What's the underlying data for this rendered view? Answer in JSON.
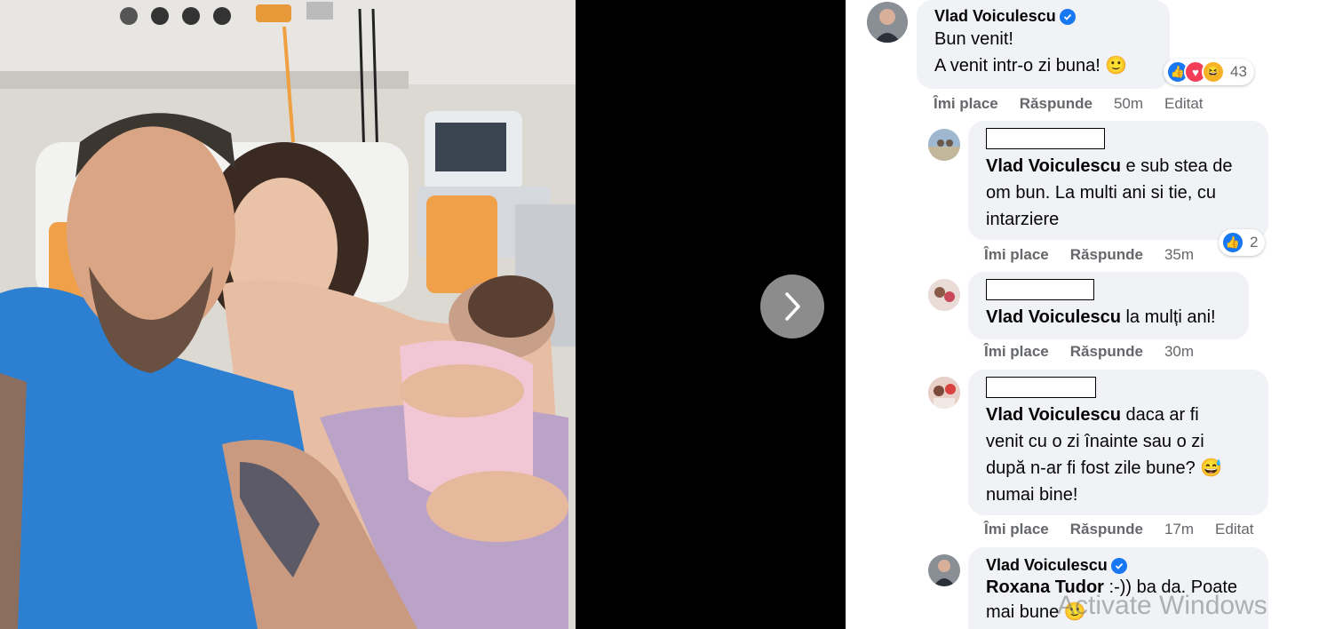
{
  "next_button_label": "›",
  "comments": [
    {
      "author": "Vlad Voiculescu",
      "verified": true,
      "lines": [
        "Bun venit!",
        "A venit intr-o zi buna! 🙂"
      ],
      "reactions": [
        "like",
        "love",
        "haha"
      ],
      "reaction_count": "43",
      "like_label": "Îmi place",
      "reply_label": "Răspunde",
      "time": "50m",
      "edited": "Editat"
    },
    {
      "mention": "Vlad Voiculescu",
      "text_first": " e sub stea de",
      "lines": [
        "om bun. La multi ani si tie, cu",
        "intarziere"
      ],
      "reactions": [
        "like"
      ],
      "reaction_count": "2",
      "like_label": "Îmi place",
      "reply_label": "Răspunde",
      "time": "35m"
    },
    {
      "mention": "Vlad Voiculescu",
      "text_first": " la mulți ani!",
      "like_label": "Îmi place",
      "reply_label": "Răspunde",
      "time": "30m"
    },
    {
      "mention": "Vlad Voiculescu",
      "text_first": " daca ar fi",
      "lines": [
        "venit cu o zi înainte sau o zi",
        "după n-ar fi fost zile bune? 😅",
        "numai bine!"
      ],
      "like_label": "Îmi place",
      "reply_label": "Răspunde",
      "time": "17m",
      "edited": "Editat"
    },
    {
      "author": "Vlad Voiculescu",
      "verified": true,
      "mention": "Roxana Tudor",
      "text_first": " :-)) ba da. Poate",
      "lines": [
        "mai bune 🙂"
      ]
    }
  ],
  "watermark": "Activate Windows",
  "colors": {
    "accent": "#1877f2",
    "bubble": "#f0f2f5",
    "meta_text": "#65676b"
  }
}
